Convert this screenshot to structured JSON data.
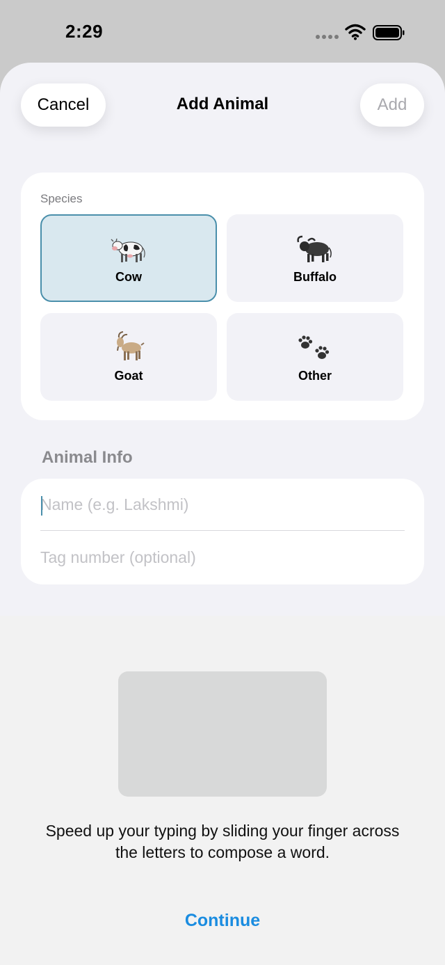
{
  "status_bar": {
    "time": "2:29"
  },
  "nav": {
    "cancel_label": "Cancel",
    "title": "Add Animal",
    "add_label": "Add"
  },
  "species": {
    "label": "Species",
    "selected": "Cow",
    "options": [
      {
        "label": "Cow",
        "icon": "cow-icon"
      },
      {
        "label": "Buffalo",
        "icon": "buffalo-icon"
      },
      {
        "label": "Goat",
        "icon": "goat-icon"
      },
      {
        "label": "Other",
        "icon": "paw-prints-icon"
      }
    ]
  },
  "animal_info": {
    "header": "Animal Info",
    "name_placeholder": "Name (e.g. Lakshmi)",
    "tag_placeholder": "Tag number (optional)"
  },
  "slide_typing_tip": {
    "text": "Speed up your typing by sliding your finger across the letters to compose a word.",
    "continue_label": "Continue"
  },
  "colors": {
    "accent": "#4a8fab",
    "selected_tile_bg": "#d9e8ef",
    "link_blue": "#1a8ce0"
  }
}
